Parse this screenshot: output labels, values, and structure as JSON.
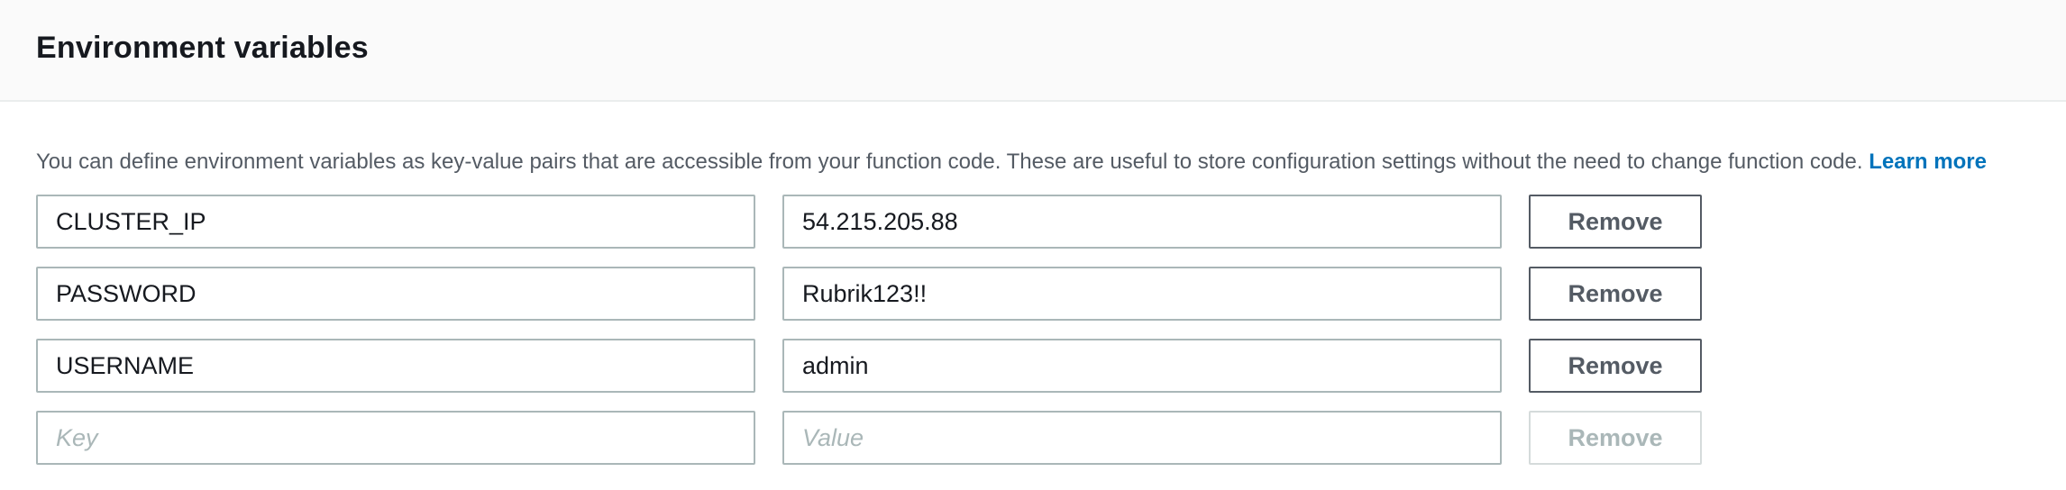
{
  "panel": {
    "title": "Environment variables",
    "description": "You can define environment variables as key-value pairs that are accessible from your function code. These are useful to store configuration settings without the need to change function code.",
    "learn_more": "Learn more"
  },
  "variables": [
    {
      "key": "CLUSTER_IP",
      "value": "54.215.205.88",
      "remove_label": "Remove"
    },
    {
      "key": "PASSWORD",
      "value": "Rubrik123!!",
      "remove_label": "Remove"
    },
    {
      "key": "USERNAME",
      "value": "admin",
      "remove_label": "Remove"
    }
  ],
  "new_row": {
    "key_placeholder": "Key",
    "value_placeholder": "Value",
    "remove_label": "Remove"
  },
  "colors": {
    "header_bg": "#fafafa",
    "link": "#0073bb",
    "border": "#aab7b8",
    "button_border": "#545b64"
  }
}
